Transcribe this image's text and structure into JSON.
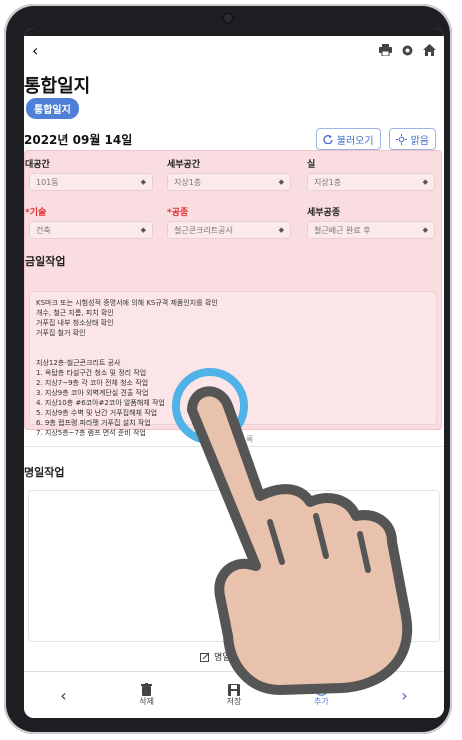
{
  "header": {
    "back_glyph": "‹",
    "icons": [
      "printer-icon",
      "gear-icon",
      "home-icon"
    ]
  },
  "page": {
    "title": "통합일지",
    "chip": "통합일지",
    "date": "2022년 09월 14일",
    "recall_btn": "불러오기",
    "weather_btn": "맑음"
  },
  "form": {
    "row1": [
      {
        "label": "대공간",
        "value": "101동",
        "required": false
      },
      {
        "label": "세부공간",
        "value": "지상1층",
        "required": false
      },
      {
        "label": "실",
        "value": "지상1층",
        "required": false
      }
    ],
    "row2": [
      {
        "label": "*기술",
        "value": "건축",
        "required": true
      },
      {
        "label": "*공종",
        "value": "철근콘크리트공사",
        "required": true
      },
      {
        "label": "세부공종",
        "value": "철근배근 완료 후",
        "required": false
      }
    ]
  },
  "today": {
    "title": "금일작업",
    "lines": [
      "KS마크 또는 시험성적 증명서에 의해 KS규격 제품인지를 확인",
      "개수, 철근 지름, 피치 확인",
      "거푸집 내부 청소상태 확인",
      "거푸집 철거 확인",
      "",
      "",
      "지상12층-철근콘크리트 공사",
      "1. 옥탑층 타설구간 청소 및 정리 작업",
      "2. 지상7~9층 각 코아 전체 청소 작업",
      "3. 지상9층 코아 외벽계단실 견출 작업",
      "4. 지상10층 #6코아#2코아 알폼해체 작업",
      "5. 지상9층 수벽 및 난간 거푸집해체 작업",
      "6. 9층 랩프랭 파라펫 거푸집 설치 작업",
      "7. 지상5층~7층 램프 면석 준비 작업"
    ],
    "partial_word": "록"
  },
  "tomorrow": {
    "title": "명일작업",
    "add_label": "명일작업"
  },
  "bottom_nav": {
    "delete": "삭제",
    "save": "저장",
    "add": "추가",
    "prev": "‹",
    "next": "›"
  },
  "colors": {
    "accent": "#4f7fd6",
    "pink_bg": "#f9dde0",
    "required": "#e03131"
  }
}
